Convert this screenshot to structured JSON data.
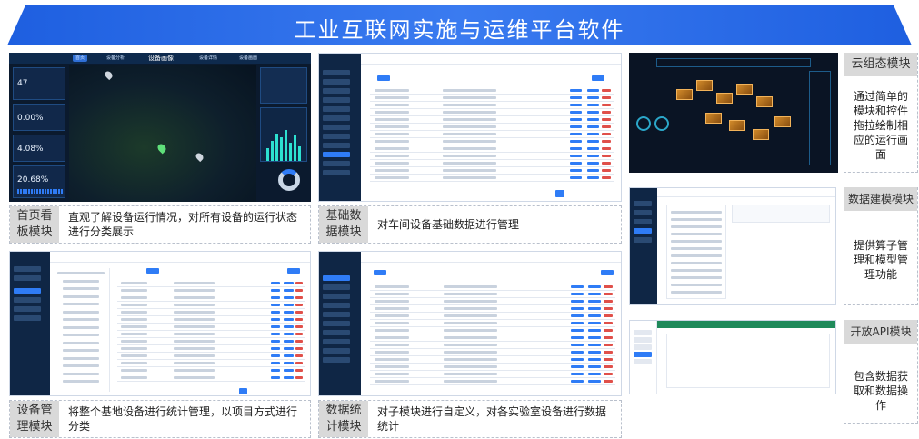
{
  "header": {
    "title": "工业互联网实施与运维平台软件"
  },
  "panels": {
    "home": {
      "tag": "首页看板模块",
      "desc": "直观了解设备运行情况，对所有设备的运行状态进行分类展示",
      "screen": {
        "tabs": [
          "首页",
          "设备分析",
          "设备画像",
          "设备详情",
          "设备画面"
        ],
        "kpis": [
          {
            "value": "47"
          },
          {
            "value": "0.00%"
          },
          {
            "value": "4.08%"
          },
          {
            "value": "20.68%"
          }
        ]
      }
    },
    "basic": {
      "tag": "基础数据模块",
      "desc": "对车间设备基础数据进行管理"
    },
    "device": {
      "tag": "设备管理模块",
      "desc": "将整个基地设备进行统计管理，以项目方式进行分类"
    },
    "stats": {
      "tag": "数据统计模块",
      "desc": "对子模块进行自定义，对各实验室设备进行数据统计"
    },
    "cloud": {
      "tag": "云组态模块",
      "desc": "通过简单的模块和控件拖拉绘制相应的运行画面"
    },
    "model": {
      "tag": "数据建模模块",
      "desc": "提供算子管理和模型管理功能"
    },
    "api": {
      "tag": "开放API模块",
      "desc": "包含数据获取和数据操作"
    }
  },
  "colors": {
    "banner": "#1e5fe0",
    "dark_bg": "#0b1a2e",
    "accent": "#2f7cf6",
    "tag_bg": "#d9d9d9"
  }
}
